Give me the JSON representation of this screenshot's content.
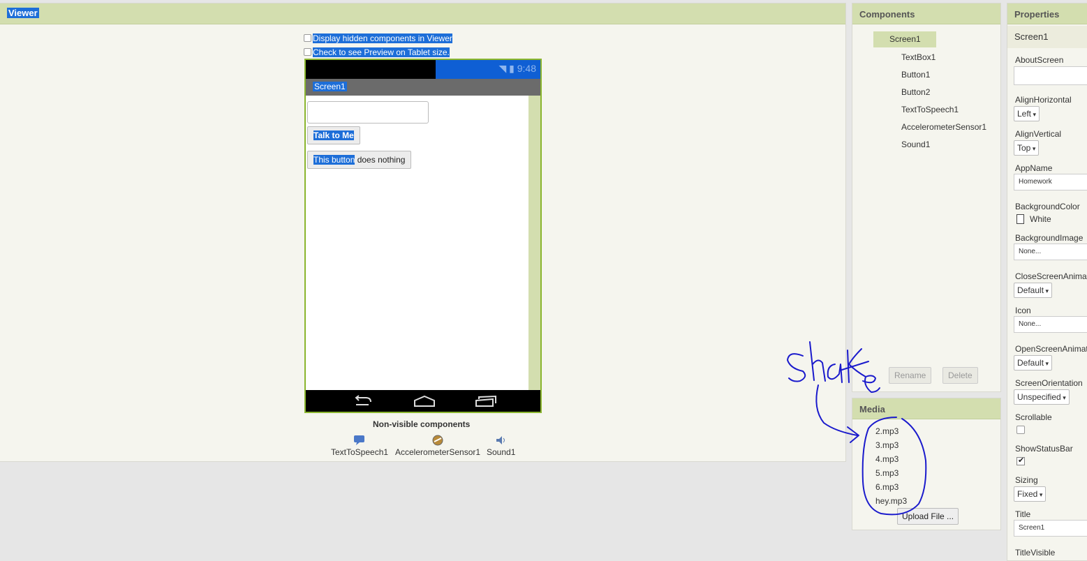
{
  "viewer": {
    "title": "Viewer",
    "display_hidden_label": "Display hidden components in Viewer",
    "tablet_preview_label": "Check to see Preview on Tablet size.",
    "phone": {
      "time": "9:48",
      "screen_title": "Screen1",
      "button1_label": "Talk to Me",
      "button2_highlight": "This button",
      "button2_rest": " does nothing"
    },
    "nonvisible_title": "Non-visible components",
    "nonvisible_items": [
      "TextToSpeech1",
      "AccelerometerSensor1",
      "Sound1"
    ]
  },
  "components": {
    "title": "Components",
    "root": "Screen1",
    "children": [
      "TextBox1",
      "Button1",
      "Button2",
      "TextToSpeech1",
      "AccelerometerSensor1",
      "Sound1"
    ],
    "rename_label": "Rename",
    "delete_label": "Delete"
  },
  "media": {
    "title": "Media",
    "files": [
      "2.mp3",
      "3.mp3",
      "4.mp3",
      "5.mp3",
      "6.mp3",
      "hey.mp3"
    ],
    "upload_label": "Upload File ..."
  },
  "properties": {
    "title": "Properties",
    "selected": "Screen1",
    "about_screen": {
      "label": "AboutScreen",
      "value": ""
    },
    "align_horizontal": {
      "label": "AlignHorizontal",
      "value": "Left"
    },
    "align_vertical": {
      "label": "AlignVertical",
      "value": "Top"
    },
    "app_name": {
      "label": "AppName",
      "value": "Homework"
    },
    "background_color": {
      "label": "BackgroundColor",
      "value": "White"
    },
    "background_image": {
      "label": "BackgroundImage",
      "value": "None..."
    },
    "close_screen_animation": {
      "label": "CloseScreenAnimat",
      "value": "Default"
    },
    "icon": {
      "label": "Icon",
      "value": "None..."
    },
    "open_screen_animation": {
      "label": "OpenScreenAnimat",
      "value": "Default"
    },
    "screen_orientation": {
      "label": "ScreenOrientation",
      "value": "Unspecified"
    },
    "scrollable": {
      "label": "Scrollable",
      "checked": false
    },
    "show_status_bar": {
      "label": "ShowStatusBar",
      "checked": true
    },
    "sizing": {
      "label": "Sizing",
      "value": "Fixed"
    },
    "title_prop": {
      "label": "Title",
      "value": "Screen1"
    },
    "title_visible": {
      "label": "TitleVisible"
    }
  },
  "annotation": {
    "handwritten_text": "shake",
    "ink_color": "#1a1acc"
  },
  "colors": {
    "header": "#d3deaf",
    "selection": "#1d6ed8",
    "phone_border": "#8ab52e"
  }
}
